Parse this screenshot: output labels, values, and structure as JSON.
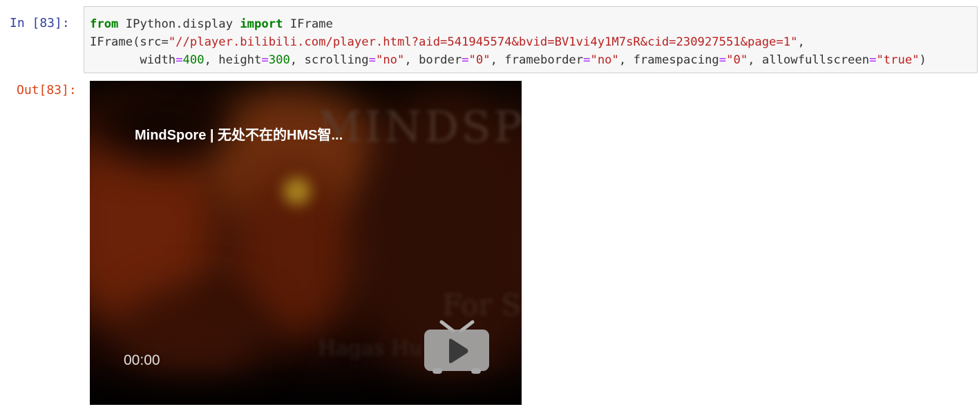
{
  "cell": {
    "in_prompt": "In  [83]:",
    "out_prompt": "Out[83]:",
    "code_lines": [
      "from IPython.display import IFrame",
      "IFrame(src=\"//player.bilibili.com/player.html?aid=541945574&bvid=BV1vi4y1M7sR&cid=230927551&page=1\",",
      "       width=400, height=300, scrolling=\"no\", border=\"0\", frameborder=\"no\", framespacing=\"0\", allowfullscreen=\"true\")"
    ]
  },
  "player": {
    "title": "MindSpore | 无处不在的HMS智...",
    "time": "00:00",
    "play_icon": "tv-play-icon"
  },
  "colors": {
    "in_prompt": "#303f9f",
    "out_prompt": "#d84315",
    "keyword": "#008000",
    "string": "#ba2121"
  }
}
